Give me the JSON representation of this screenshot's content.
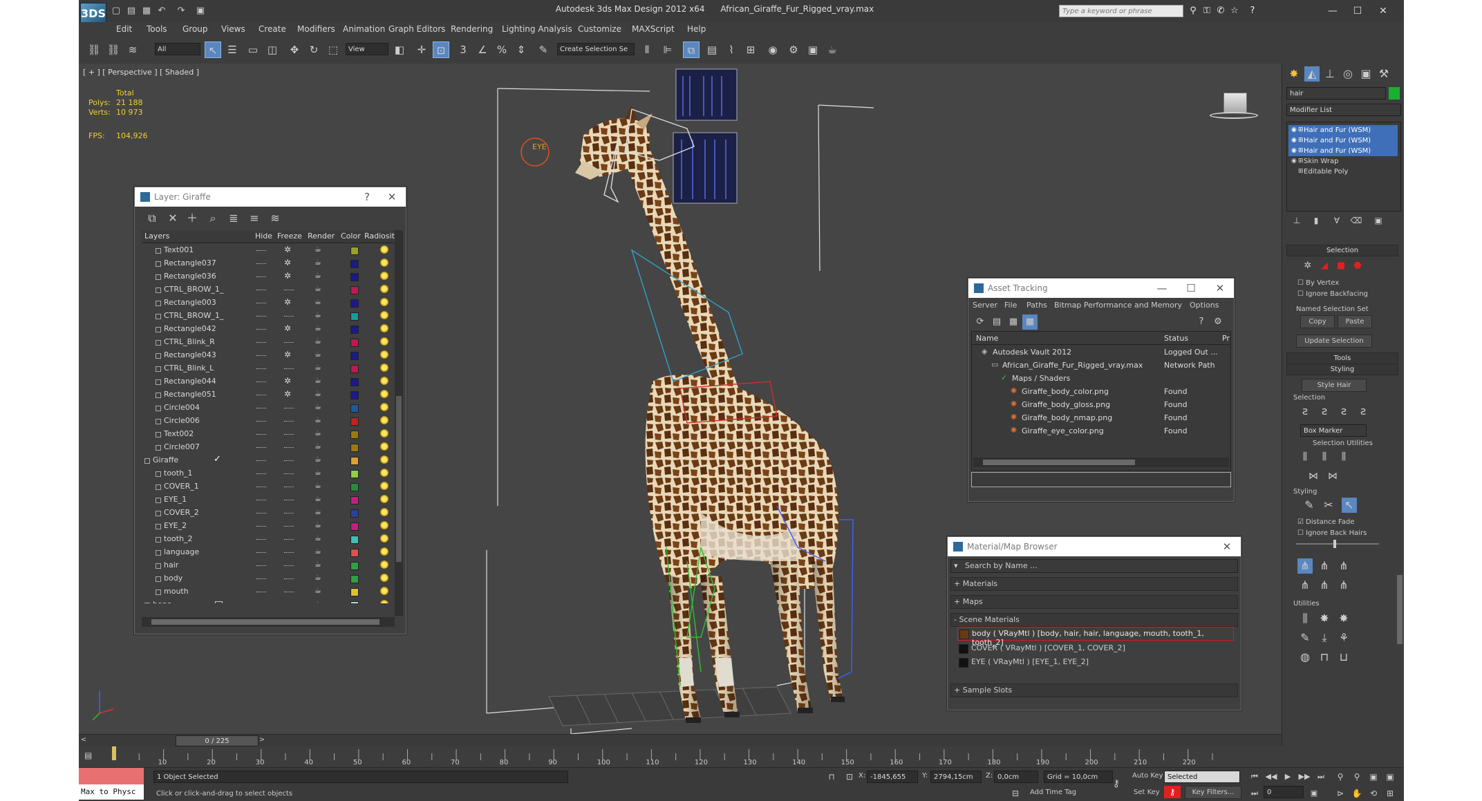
{
  "app": {
    "title": "Autodesk 3ds Max Design 2012 x64",
    "file": "African_Giraffe_Fur_Rigged_vray.max",
    "logo_text": "3DS",
    "search_placeholder": "Type a keyword or phrase"
  },
  "menu": [
    "Edit",
    "Tools",
    "Group",
    "Views",
    "Create",
    "Modifiers",
    "Animation",
    "Graph Editors",
    "Rendering",
    "Lighting Analysis",
    "Customize",
    "MAXScript",
    "Help"
  ],
  "toolbar": {
    "selection_filter": "All",
    "ref_coord": "View",
    "named_selection": "Create Selection Se"
  },
  "viewport": {
    "label": "[ + ] [ Perspective ] [ Shaded ]",
    "stats_header": "Total",
    "polys_label": "Polys:",
    "polys_value": "21 188",
    "verts_label": "Verts:",
    "verts_value": "10 973",
    "fps_label": "FPS:",
    "fps_value": "104,926",
    "eye_label": "EYE"
  },
  "layer_window": {
    "title": "Layer: Giraffe",
    "help": "?",
    "columns": [
      "Layers",
      "Hide",
      "Freeze",
      "Render",
      "Color",
      "Radiosity"
    ],
    "rows": [
      {
        "name": "Text001",
        "color": "#9aa028",
        "freeze": true,
        "indent": 1
      },
      {
        "name": "Rectangle037",
        "color": "#1a1a8a",
        "freeze": true,
        "indent": 1
      },
      {
        "name": "Rectangle036",
        "color": "#1a1a8a",
        "freeze": true,
        "indent": 1
      },
      {
        "name": "CTRL_BROW_1_",
        "color": "#c01850",
        "freeze": false,
        "indent": 1
      },
      {
        "name": "Rectangle003",
        "color": "#1a1a8a",
        "freeze": true,
        "indent": 1
      },
      {
        "name": "CTRL_BROW_1_",
        "color": "#1a9a9a",
        "freeze": false,
        "indent": 1
      },
      {
        "name": "Rectangle042",
        "color": "#1a1a8a",
        "freeze": true,
        "indent": 1
      },
      {
        "name": "CTRL_Blink_R",
        "color": "#c01850",
        "freeze": false,
        "indent": 1
      },
      {
        "name": "Rectangle043",
        "color": "#1a1a8a",
        "freeze": true,
        "indent": 1
      },
      {
        "name": "CTRL_Blink_L",
        "color": "#c01850",
        "freeze": false,
        "indent": 1
      },
      {
        "name": "Rectangle044",
        "color": "#1a1a8a",
        "freeze": true,
        "indent": 1
      },
      {
        "name": "Rectangle051",
        "color": "#1a1a8a",
        "freeze": true,
        "indent": 1
      },
      {
        "name": "Circle004",
        "color": "#1a5aa0",
        "freeze": false,
        "indent": 1
      },
      {
        "name": "Circle006",
        "color": "#c02020",
        "freeze": false,
        "indent": 1
      },
      {
        "name": "Text002",
        "color": "#9a7a10",
        "freeze": false,
        "indent": 1
      },
      {
        "name": "Circle007",
        "color": "#9a7a10",
        "freeze": false,
        "indent": 1
      },
      {
        "name": "Giraffe",
        "color": "#e0a030",
        "freeze": false,
        "indent": 0,
        "current": true
      },
      {
        "name": "tooth_1",
        "color": "#90d040",
        "freeze": false,
        "indent": 1
      },
      {
        "name": "COVER_1",
        "color": "#2a8a40",
        "freeze": false,
        "indent": 1
      },
      {
        "name": "EYE_1",
        "color": "#c02080",
        "freeze": false,
        "indent": 1
      },
      {
        "name": "COVER_2",
        "color": "#2a40a0",
        "freeze": false,
        "indent": 1
      },
      {
        "name": "EYE_2",
        "color": "#c02080",
        "freeze": false,
        "indent": 1
      },
      {
        "name": "tooth_2",
        "color": "#40c0b0",
        "freeze": false,
        "indent": 1
      },
      {
        "name": "language",
        "color": "#e05050",
        "freeze": false,
        "indent": 1
      },
      {
        "name": "hair",
        "color": "#30a040",
        "freeze": false,
        "indent": 1
      },
      {
        "name": "body",
        "color": "#30a040",
        "freeze": false,
        "indent": 1
      },
      {
        "name": "mouth",
        "color": "#e0c030",
        "freeze": false,
        "indent": 1
      },
      {
        "name": "bone",
        "color": "#a0e0e0",
        "freeze": false,
        "indent": 0,
        "box": true
      }
    ]
  },
  "asset_window": {
    "title": "Asset Tracking",
    "menu": [
      "Server",
      "File",
      "Paths",
      "Bitmap Performance and Memory",
      "Options"
    ],
    "columns": [
      "Name",
      "Status",
      "Pr"
    ],
    "rows": [
      {
        "name": "Autodesk Vault 2012",
        "status": "Logged Out ...",
        "indent": 0
      },
      {
        "name": "African_Giraffe_Fur_Rigged_vray.max",
        "status": "Network Path",
        "indent": 1
      },
      {
        "name": "Maps / Shaders",
        "status": "",
        "indent": 2
      },
      {
        "name": "Giraffe_body_color.png",
        "status": "Found",
        "indent": 3
      },
      {
        "name": "Giraffe_body_gloss.png",
        "status": "Found",
        "indent": 3
      },
      {
        "name": "Giraffe_body_nmap.png",
        "status": "Found",
        "indent": 3
      },
      {
        "name": "Giraffe_eye_color.png",
        "status": "Found",
        "indent": 3
      }
    ]
  },
  "material_window": {
    "title": "Material/Map Browser",
    "search_placeholder": "Search by Name ...",
    "groups": [
      "+ Materials",
      "+ Maps",
      "- Scene Materials"
    ],
    "materials": [
      "body  ( VRayMtl ) [body, hair, hair, language, mouth, tooth_1, tooth_2]",
      "COVER  ( VRayMtl ) [COVER_1, COVER_2]",
      "EYE  ( VRayMtl ) [EYE_1, EYE_2]"
    ],
    "sample_slots": "+ Sample Slots"
  },
  "command_panel": {
    "object_name": "hair",
    "object_color": "#18b030",
    "modifier_list": "Modifier List",
    "stack": [
      "Hair and Fur (WSM)",
      "Hair and Fur (WSM)",
      "Hair and Fur (WSM)",
      "Skin Wrap",
      "Editable Poly"
    ],
    "selection_rollout": "Selection",
    "by_vertex": "By Vertex",
    "ignore_backfacing": "Ignore Backfacing",
    "named_sel_set": "Named Selection Set",
    "copy": "Copy",
    "paste": "Paste",
    "update_selection": "Update Selection",
    "tools_rollout": "Tools",
    "styling_rollout": "Styling",
    "style_hair": "Style Hair",
    "selection_group": "Selection",
    "box_marker": "Box Marker",
    "selection_utilities": "Selection Utilities",
    "styling_group": "Styling",
    "distance_fade": "Distance Fade",
    "ignore_back_hairs": "Ignore Back Hairs",
    "utilities_group": "Utilities"
  },
  "timeline": {
    "frame_counter": "0 / 225",
    "ticks": [
      "10",
      "20",
      "30",
      "40",
      "50",
      "60",
      "70",
      "80",
      "90",
      "100",
      "110",
      "120",
      "130",
      "140",
      "150",
      "160",
      "170",
      "180",
      "190",
      "200",
      "210",
      "220"
    ]
  },
  "status": {
    "maxscript": "Max to Physc",
    "objects_selected": "1 Object Selected",
    "prompt": "Click or click-and-drag to select objects",
    "x_label": "X:",
    "x_value": "-1845,655",
    "y_label": "Y:",
    "y_value": "2794,15cm",
    "z_label": "Z:",
    "z_value": "0,0cm",
    "grid": "Grid = 10,0cm",
    "add_time_tag": "Add Time Tag",
    "auto_key": "Auto Key",
    "auto_key_value": "Selected",
    "set_key": "Set Key",
    "key_filters": "Key Filters...",
    "frame_value": "0"
  }
}
